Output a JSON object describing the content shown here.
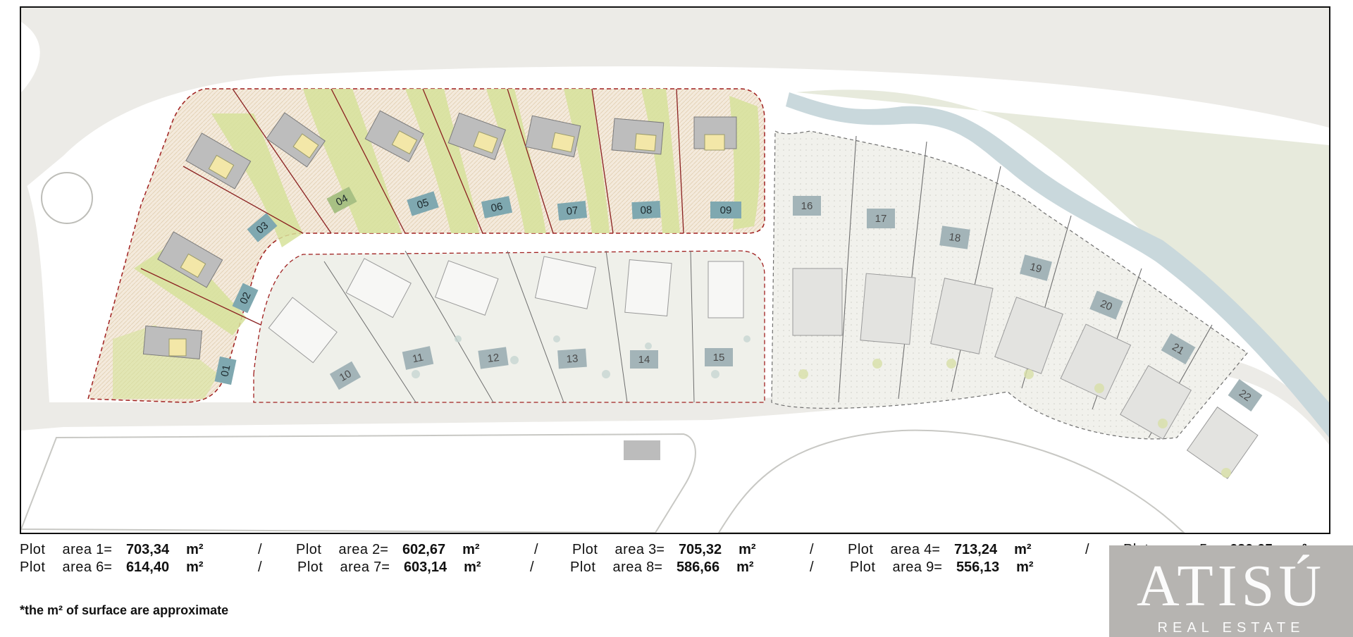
{
  "map": {
    "sold_plots": [
      "01",
      "02",
      "03",
      "04",
      "05",
      "06",
      "07",
      "08",
      "09"
    ],
    "row_plots": [
      "10",
      "11",
      "12",
      "13",
      "14",
      "15"
    ],
    "east_plots": [
      "16",
      "17",
      "18",
      "19",
      "20",
      "21",
      "22"
    ]
  },
  "plot_areas": {
    "label": "Plot area",
    "unit": "m²",
    "separator": "/",
    "rows": [
      [
        {
          "num": "1",
          "value": "703,34"
        },
        {
          "num": "2",
          "value": "602,67"
        },
        {
          "num": "3",
          "value": "705,32"
        },
        {
          "num": "4",
          "value": "713,24"
        },
        {
          "num": "5",
          "value": "620,65"
        }
      ],
      [
        {
          "num": "6",
          "value": "614,40"
        },
        {
          "num": "7",
          "value": "603,14"
        },
        {
          "num": "8",
          "value": "586,66"
        },
        {
          "num": "9",
          "value": "556,13"
        }
      ]
    ]
  },
  "note": "*the m² of surface are approximate",
  "logo": {
    "name": "ATISÚ",
    "tagline": "REAL ESTATE"
  },
  "colors": {
    "road": "#ecebe7",
    "green": "#d6e29a",
    "river": "#c9d8dc",
    "sold_label": "#7fa8b0",
    "plot_label": "#a3b4b8",
    "boundary_red": "#a02020",
    "logo_bg": "#b6b4b1"
  }
}
